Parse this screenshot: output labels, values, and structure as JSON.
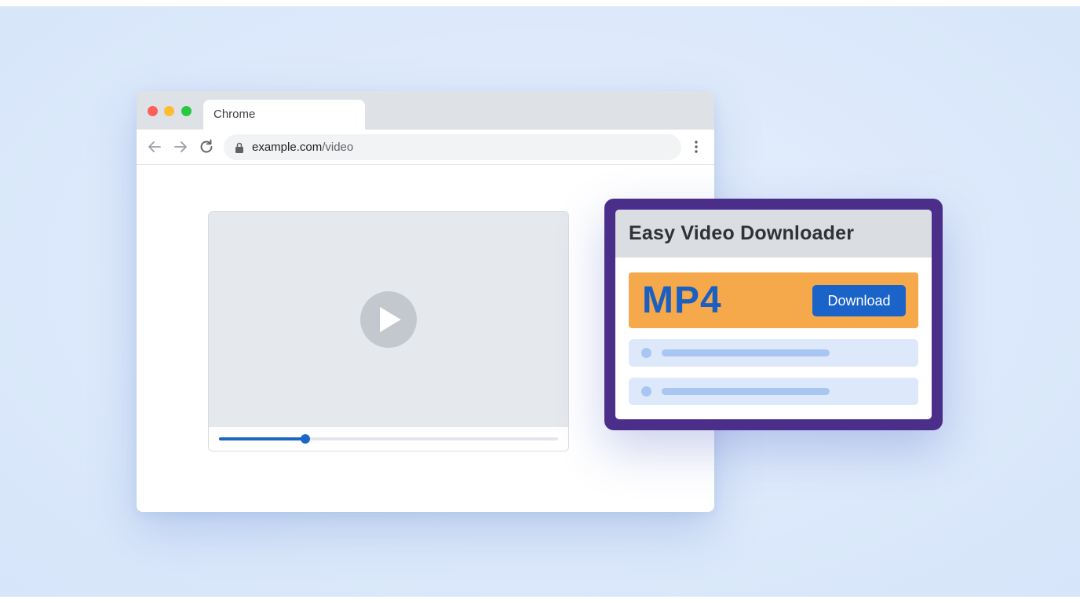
{
  "browser": {
    "tab_title": "Chrome",
    "address": {
      "host": "example.com",
      "path": "/video"
    }
  },
  "player": {
    "progress": 0.255
  },
  "extension": {
    "title": "Easy Video Downloader",
    "format": "MP4",
    "download_label": "Download",
    "border_color": "#4b2e8a",
    "format_row_color": "#f5a94a",
    "accent_color": "#1a63c8"
  },
  "icons": {
    "window_controls": [
      "close-dot",
      "minimize-dot",
      "maximize-dot"
    ],
    "toolbar": [
      "back-arrow-icon",
      "forward-arrow-icon",
      "reload-icon",
      "lock-icon",
      "kebab-menu-icon"
    ],
    "player": [
      "play-icon"
    ]
  }
}
